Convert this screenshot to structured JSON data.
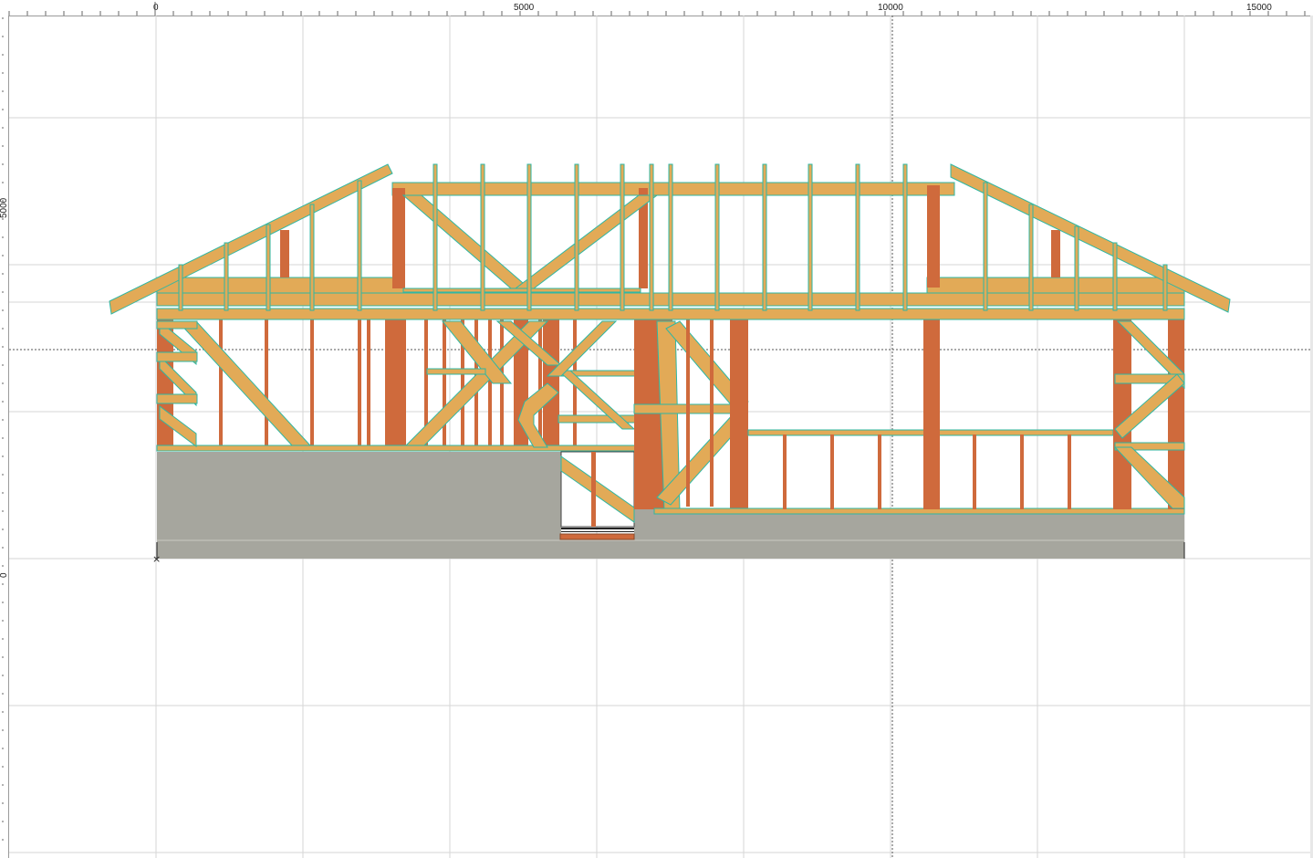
{
  "window": {
    "title": ""
  },
  "ruler": {
    "horizontal_labels": [
      "0",
      "5000",
      "10000",
      "15000"
    ],
    "vertical_labels": [
      "5000",
      "0"
    ]
  },
  "drawing": {
    "view": "elevation",
    "subject": "timber wall and roof framing",
    "colors": {
      "timber_light": "#E2AA57",
      "timber_dark": "#CF6A3C",
      "outline": "#2FB7A3",
      "foundation": "#A6A69E",
      "grid": "#D6D6D6",
      "background": "#FFFFFF"
    }
  }
}
